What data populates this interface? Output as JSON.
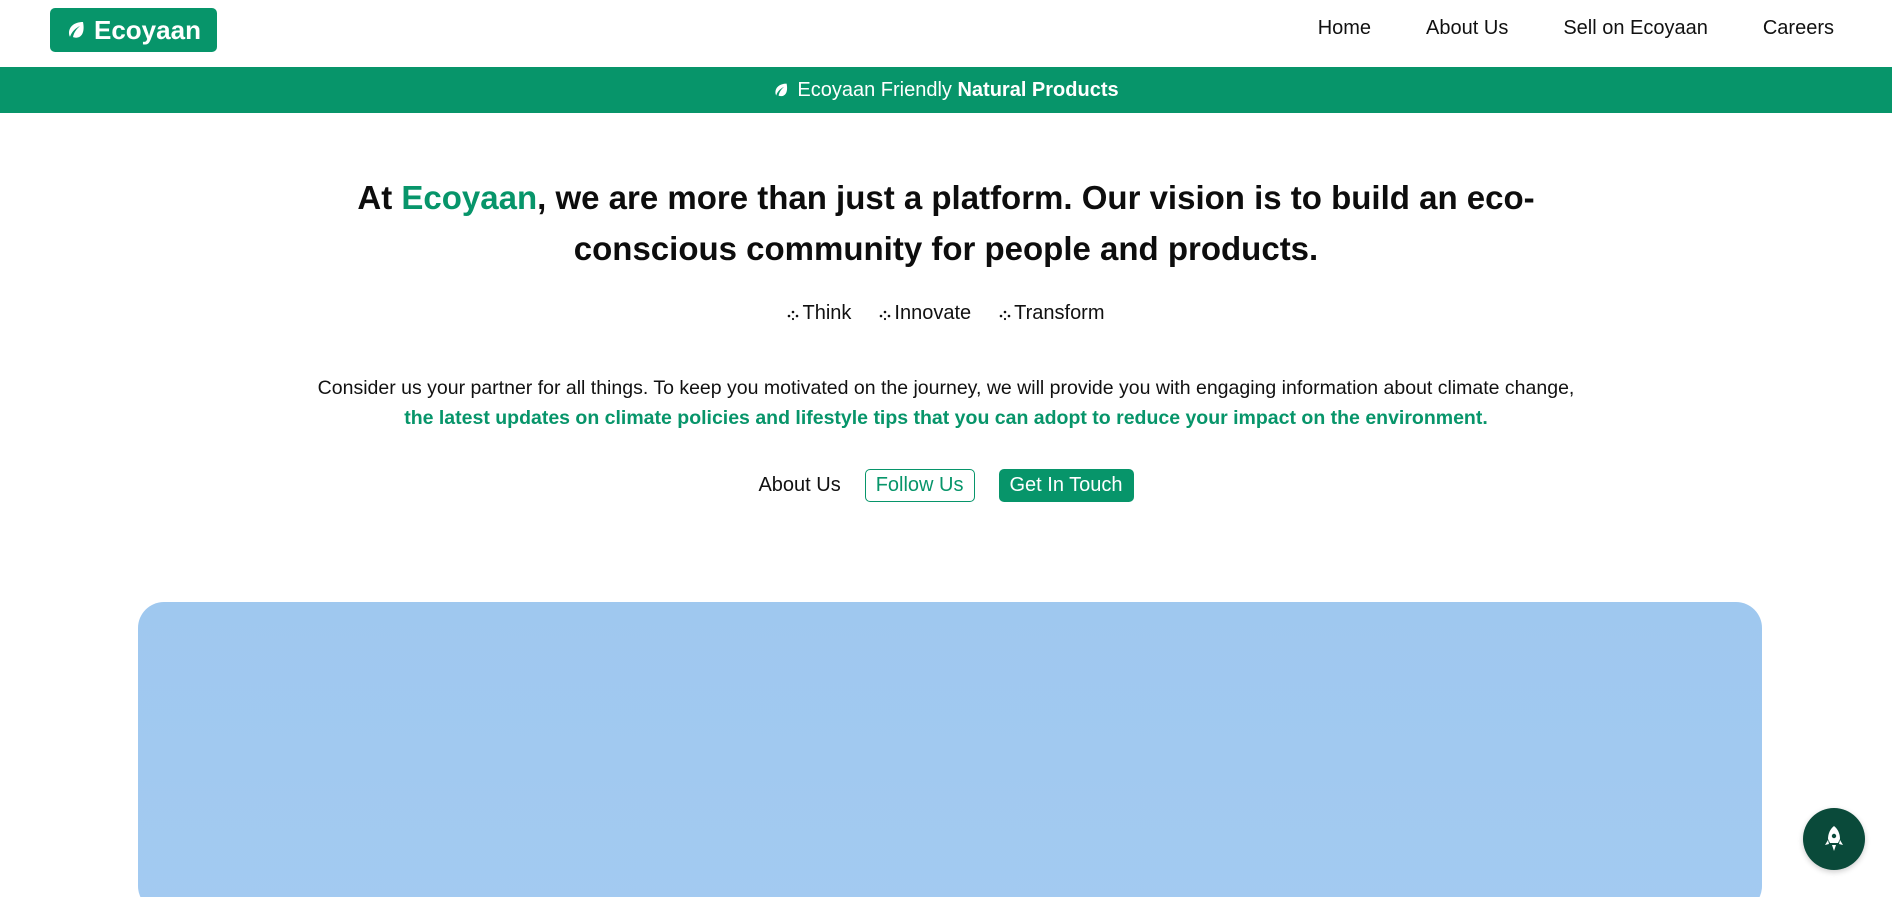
{
  "colors": {
    "brand": "#07956a",
    "fab": "#0a4a3a",
    "hero_image": "#a1c8f0"
  },
  "navbar": {
    "logo_text": "Ecoyaan",
    "logo_icon": "leaf-icon",
    "links": [
      "Home",
      "About Us",
      "Sell on Ecoyaan",
      "Careers"
    ]
  },
  "banner": {
    "icon": "leaf-icon",
    "text_regular": "Ecoyaan Friendly",
    "text_bold": "Natural Products"
  },
  "hero": {
    "title_prefix": "At ",
    "title_accent": "Ecoyaan",
    "title_suffix": ", we are more than just a platform. Our vision is to build an eco-conscious community for people and products.",
    "pillars": [
      "Think",
      "Innovate",
      "Transform"
    ],
    "desc_line1": "Consider us your partner for all things. To keep you motivated on the journey, we will provide you with engaging information about climate change,",
    "desc_line2": "the latest updates on climate policies and lifestyle tips that you can adopt to reduce your impact on the environment."
  },
  "cta": {
    "about": "About Us",
    "follow": "Follow Us",
    "contact": "Get In Touch"
  },
  "fab": {
    "icon": "rocket-icon"
  }
}
